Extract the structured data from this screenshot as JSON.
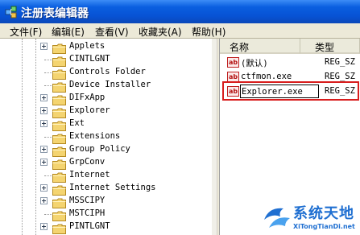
{
  "window": {
    "title": "注册表编辑器",
    "icon": "registry-editor-icon"
  },
  "menu": {
    "items": [
      "文件(F)",
      "编辑(E)",
      "查看(V)",
      "收藏夹(A)",
      "帮助(H)"
    ]
  },
  "tree": {
    "nodes": [
      {
        "label": "Applets",
        "expandable": true
      },
      {
        "label": "CINTLGNT",
        "expandable": false
      },
      {
        "label": "Controls Folder",
        "expandable": false
      },
      {
        "label": "Device Installer",
        "expandable": false
      },
      {
        "label": "DIFxApp",
        "expandable": true
      },
      {
        "label": "Explorer",
        "expandable": true
      },
      {
        "label": "Ext",
        "expandable": true
      },
      {
        "label": "Extensions",
        "expandable": false
      },
      {
        "label": "Group Policy",
        "expandable": true
      },
      {
        "label": "GrpConv",
        "expandable": true
      },
      {
        "label": "Internet",
        "expandable": false
      },
      {
        "label": "Internet Settings",
        "expandable": true
      },
      {
        "label": "MSSCIPY",
        "expandable": true
      },
      {
        "label": "MSTCIPH",
        "expandable": false
      },
      {
        "label": "PINTLGNT",
        "expandable": true
      }
    ]
  },
  "list": {
    "columns": [
      "名称",
      "类型"
    ],
    "rows": [
      {
        "name": "(默认)",
        "type": "REG_SZ"
      },
      {
        "name": "ctfmon.exe",
        "type": "REG_SZ"
      },
      {
        "name": "Explorer.exe",
        "type": "REG_SZ",
        "editing": true
      }
    ]
  },
  "watermark": {
    "title": "系统天地",
    "subtitle": "XiTongTianDi.net"
  },
  "colors": {
    "titlebar": "#0a5fe0",
    "menubar": "#ece9d8",
    "highlight_border": "#d81c1c",
    "folder": "#f4d470",
    "string_icon": "#c02020",
    "watermark": "#1f6fd1"
  }
}
